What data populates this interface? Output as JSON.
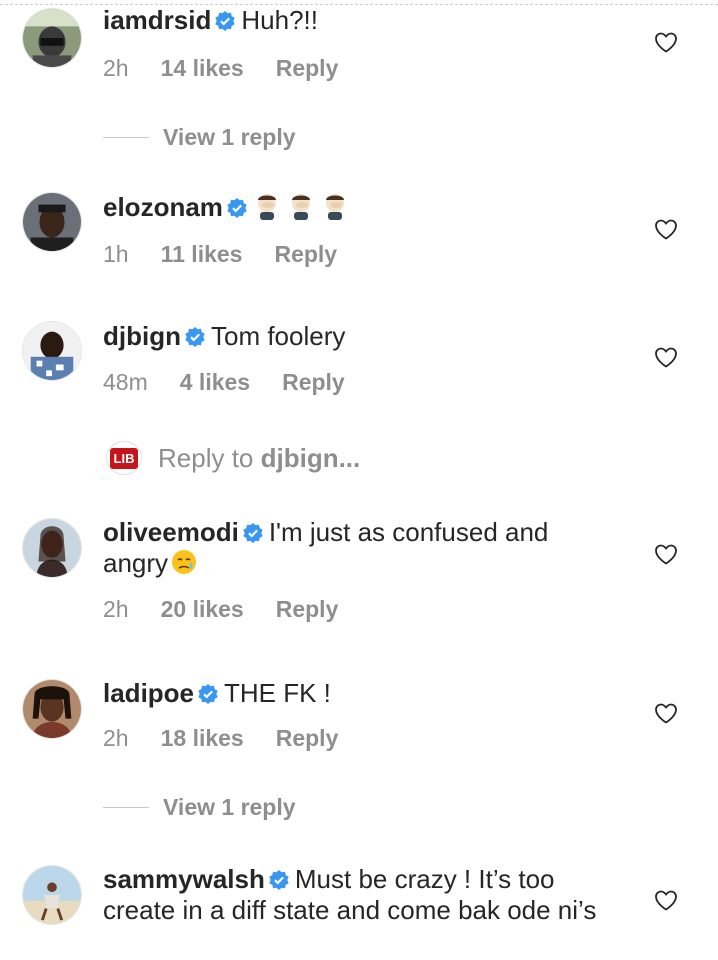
{
  "comments": [
    {
      "username": "iamdrsid",
      "text": "Huh?!!",
      "time": "2h",
      "likes": "14 likes",
      "reply": "Reply"
    },
    {
      "username": "elozonam",
      "text": "",
      "time": "1h",
      "likes": "11 likes",
      "reply": "Reply",
      "emoji": "face-palm-emoji"
    },
    {
      "username": "djbign",
      "text": "Tom foolery",
      "time": "48m",
      "likes": "4 likes",
      "reply": "Reply"
    },
    {
      "username": "oliveemodi",
      "text": "I'm just as confused and angry",
      "time": "2h",
      "likes": "20 likes",
      "reply": "Reply",
      "emoji": "disappointed-relieved-emoji"
    },
    {
      "username": "ladipoe",
      "text": "THE FK !",
      "time": "2h",
      "likes": "18 likes",
      "reply": "Reply"
    },
    {
      "username": "sammywalsh",
      "text": "Must be crazy ! It’s too create in a diff state and come bak ode ni’s"
    }
  ],
  "view_reply_1": "View 1 reply",
  "view_reply_2": "View 1 reply",
  "reply_box": {
    "badge": "LIB",
    "prefix": "Reply to ",
    "target": "djbign..."
  },
  "colors": {
    "verified": "#3897f0",
    "meta": "#8e8e8e",
    "text": "#262626",
    "lib": "#c4151c"
  }
}
